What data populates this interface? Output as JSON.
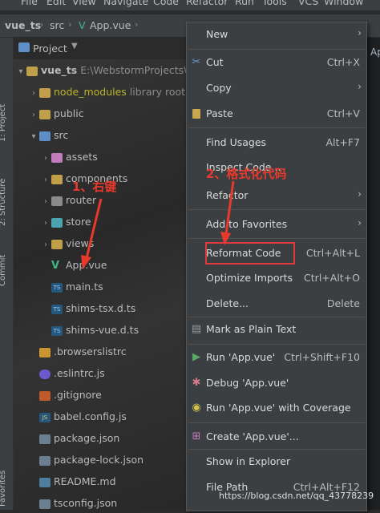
{
  "menubar": {
    "items": [
      "File",
      "Edit",
      "View",
      "Navigate",
      "Code",
      "Refactor",
      "Run",
      "Tools",
      "VCS",
      "Window"
    ]
  },
  "navbar": {
    "crumbs": [
      "vue_ts",
      "src",
      "App.vue"
    ]
  },
  "tool_windows": {
    "left": [
      "1: Project",
      "2: Structure",
      "Commit",
      "Favorites"
    ]
  },
  "project_panel": {
    "title": "Project",
    "tree": [
      {
        "label": "vue_ts",
        "extra": "E:\\WebstormProjects\\vue",
        "icon": "folder-icon"
      },
      {
        "label": "node_modules",
        "extra": "library root",
        "icon": "folder-icon"
      },
      {
        "label": "public",
        "extra": "",
        "icon": "folder-icon"
      },
      {
        "label": "src",
        "extra": "",
        "icon": "folder-icon"
      },
      {
        "label": "assets",
        "extra": "",
        "icon": "folder-icon"
      },
      {
        "label": "components",
        "extra": "",
        "icon": "folder-icon"
      },
      {
        "label": "router",
        "extra": "",
        "icon": "folder-icon"
      },
      {
        "label": "store",
        "extra": "",
        "icon": "folder-icon"
      },
      {
        "label": "views",
        "extra": "",
        "icon": "folder-icon"
      },
      {
        "label": "App.vue",
        "extra": "",
        "icon": "vue-file-icon"
      },
      {
        "label": "main.ts",
        "extra": "",
        "icon": "ts-file-icon"
      },
      {
        "label": "shims-tsx.d.ts",
        "extra": "",
        "icon": "ts-file-icon"
      },
      {
        "label": "shims-vue.d.ts",
        "extra": "",
        "icon": "ts-file-icon"
      },
      {
        "label": ".browserslistrc",
        "extra": "",
        "icon": "config-file-icon"
      },
      {
        "label": ".eslintrc.js",
        "extra": "",
        "icon": "eslint-file-icon"
      },
      {
        "label": ".gitignore",
        "extra": "",
        "icon": "git-file-icon"
      },
      {
        "label": "babel.config.js",
        "extra": "",
        "icon": "js-file-icon"
      },
      {
        "label": "package.json",
        "extra": "",
        "icon": "json-file-icon"
      },
      {
        "label": "package-lock.json",
        "extra": "",
        "icon": "json-file-icon"
      },
      {
        "label": "README.md",
        "extra": "",
        "icon": "md-file-icon"
      },
      {
        "label": "tsconfig.json",
        "extra": "",
        "icon": "json-file-icon"
      }
    ]
  },
  "editor_tab_fragment": "Ap",
  "context_menu": {
    "items": [
      {
        "label": "New",
        "shortcut": "",
        "submenu": true,
        "icon": ""
      },
      {
        "label": "Cut",
        "shortcut": "Ctrl+X",
        "submenu": false,
        "icon": "scissors-icon"
      },
      {
        "label": "Copy",
        "shortcut": "",
        "submenu": true,
        "icon": ""
      },
      {
        "label": "Paste",
        "shortcut": "Ctrl+V",
        "submenu": false,
        "icon": "clipboard-icon"
      },
      {
        "label": "Find Usages",
        "shortcut": "Alt+F7",
        "submenu": false,
        "icon": ""
      },
      {
        "label": "Inspect Code...",
        "shortcut": "",
        "submenu": false,
        "icon": ""
      },
      {
        "label": "Refactor",
        "shortcut": "",
        "submenu": true,
        "icon": ""
      },
      {
        "label": "Add to Favorites",
        "shortcut": "",
        "submenu": true,
        "icon": ""
      },
      {
        "label": "Reformat Code",
        "shortcut": "Ctrl+Alt+L",
        "submenu": false,
        "icon": ""
      },
      {
        "label": "Optimize Imports",
        "shortcut": "Ctrl+Alt+O",
        "submenu": false,
        "icon": ""
      },
      {
        "label": "Delete...",
        "shortcut": "Delete",
        "submenu": false,
        "icon": ""
      },
      {
        "label": "Mark as Plain Text",
        "shortcut": "",
        "submenu": false,
        "icon": "plain-text-icon"
      },
      {
        "label": "Run 'App.vue'",
        "shortcut": "Ctrl+Shift+F10",
        "submenu": false,
        "icon": "run-icon"
      },
      {
        "label": "Debug 'App.vue'",
        "shortcut": "",
        "submenu": false,
        "icon": "debug-icon"
      },
      {
        "label": "Run 'App.vue' with Coverage",
        "shortcut": "",
        "submenu": false,
        "icon": "coverage-icon"
      },
      {
        "label": "Create 'App.vue'...",
        "shortcut": "",
        "submenu": false,
        "icon": "create-config-icon"
      },
      {
        "label": "Show in Explorer",
        "shortcut": "",
        "submenu": false,
        "icon": ""
      },
      {
        "label": "File Path",
        "shortcut": "Ctrl+Alt+F12",
        "submenu": false,
        "icon": ""
      }
    ]
  },
  "annotations": {
    "step1": "1、右键",
    "step2": "2、格式化代码"
  },
  "watermark": "https://blog.csdn.net/qq_43778239",
  "colors": {
    "annotation": "#e8392d",
    "menu_bg": "#3c3f41",
    "tree_bg": "#2b2b2b"
  }
}
